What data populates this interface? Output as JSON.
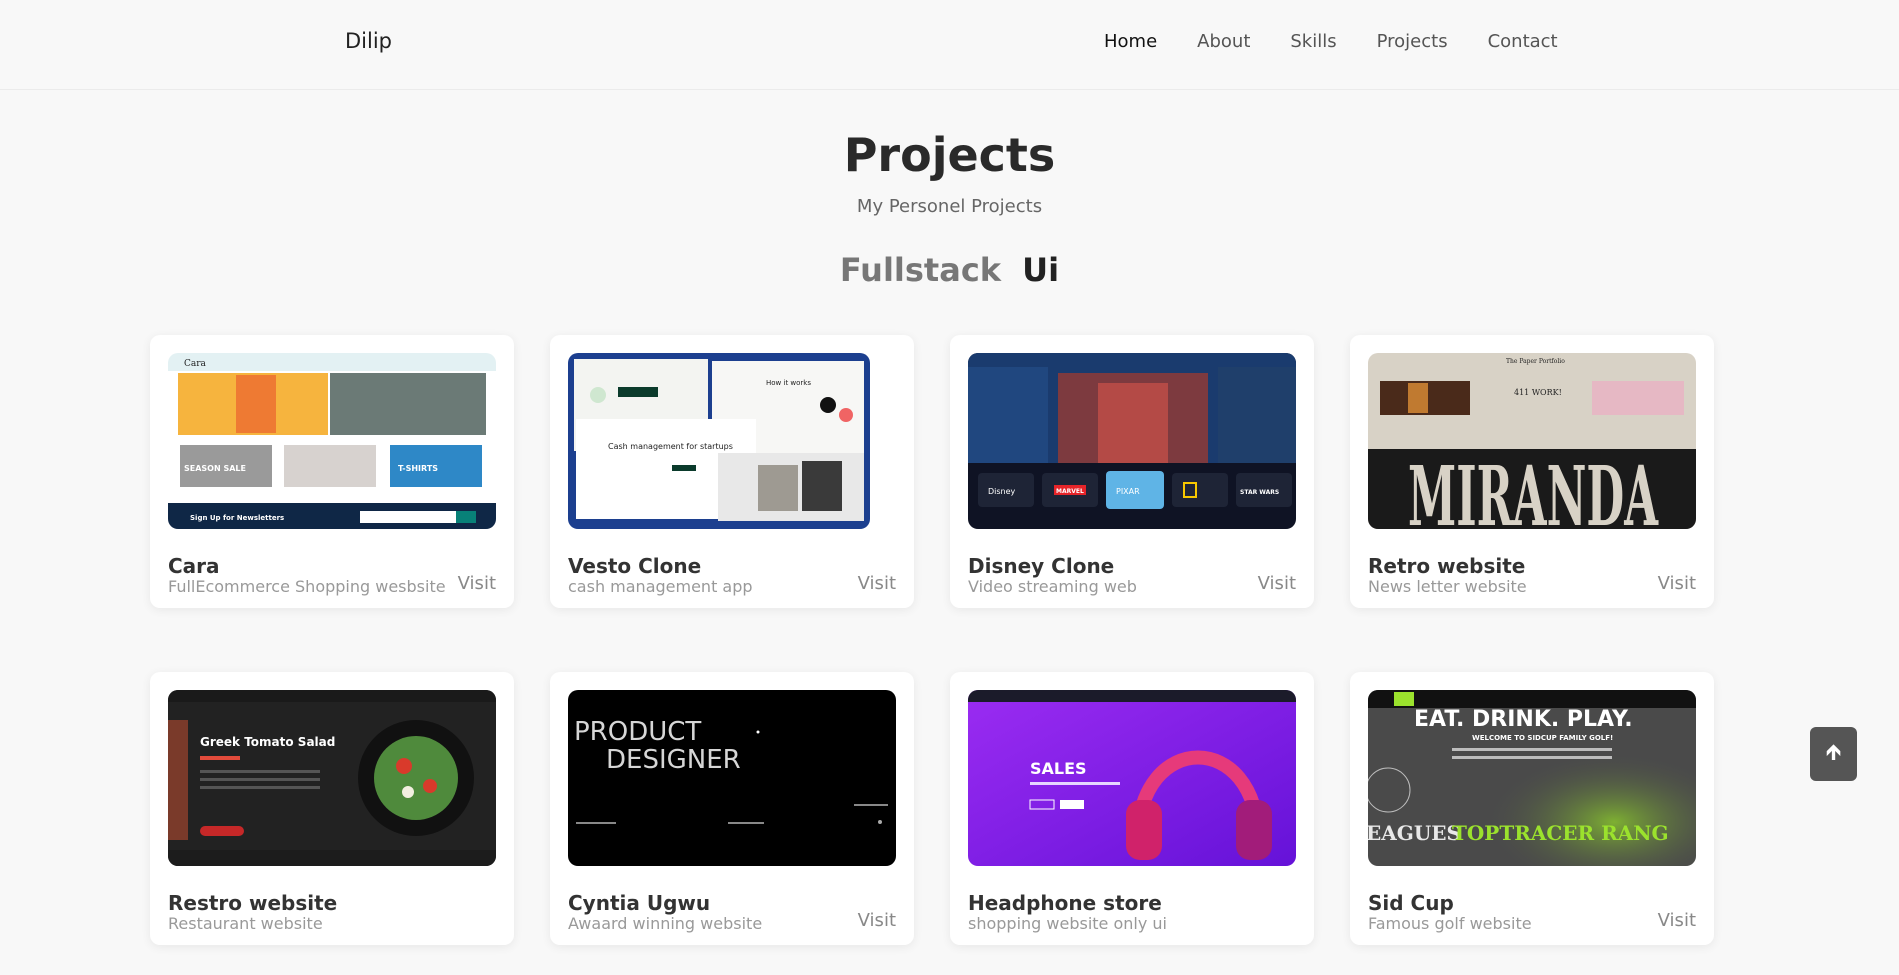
{
  "header": {
    "logo": "Dilip",
    "nav": [
      {
        "label": "Home"
      },
      {
        "label": "About"
      },
      {
        "label": "Skills"
      },
      {
        "label": "Projects"
      },
      {
        "label": "Contact"
      }
    ]
  },
  "section": {
    "title": "Projects",
    "subtitle": "My Personel Projects",
    "filters": [
      "Fullstack",
      "Ui"
    ]
  },
  "projects": [
    {
      "name": "Cara",
      "desc": "FullEcommerce Shopping wesbsite",
      "visit": "Visit"
    },
    {
      "name": "Vesto Clone",
      "desc": "cash management app",
      "visit": "Visit"
    },
    {
      "name": "Disney Clone",
      "desc": "Video streaming web",
      "visit": "Visit"
    },
    {
      "name": "Retro website",
      "desc": "News letter website",
      "visit": "Visit"
    },
    {
      "name": "Restro website",
      "desc": "Restaurant website",
      "visit": ""
    },
    {
      "name": "Cyntia Ugwu",
      "desc": "Awaard winning website",
      "visit": "Visit"
    },
    {
      "name": "Headphone store",
      "desc": "shopping website only ui",
      "visit": ""
    },
    {
      "name": "Sid Cup",
      "desc": "Famous golf website",
      "visit": "Visit"
    }
  ],
  "thumb_text": {
    "cara_newsletter": "Sign Up for Newsletters",
    "cara_season": "SEASON SALE",
    "cara_tshirts": "T-SHIRTS",
    "vesto_headline": "Cash management for startups",
    "vesto_flow": "How it works",
    "disney_logo": "Disney",
    "disney_marvel": "MARVEL",
    "disney_pixar": "PIXAR",
    "disney_starwars": "STAR WARS",
    "retro_masthead": "The Paper Portfolio",
    "retro_big": "MIRANDA",
    "retro_aside": "411 WORK!",
    "restro_dish": "Greek Tomato Salad",
    "cyntia_big1": "PRODUCT",
    "cyntia_big2": "DESIGNER",
    "headphone_sales": "SALES",
    "sidcup_big": "EAT. DRINK. PLAY.",
    "sidcup_welcome": "WELCOME TO SIDCUP FAMILY GOLF!",
    "sidcup_ticker1": "EAGUES",
    "sidcup_ticker2": "TOPTRACER RANG"
  },
  "scroll_top_icon": "arrow-up-icon",
  "colors": {
    "background": "#f8f8f8",
    "card": "#ffffff",
    "scroll_top_button": "#555555",
    "headphone_purple": "#8a1cf0",
    "sidcup_green": "#9be22d"
  }
}
